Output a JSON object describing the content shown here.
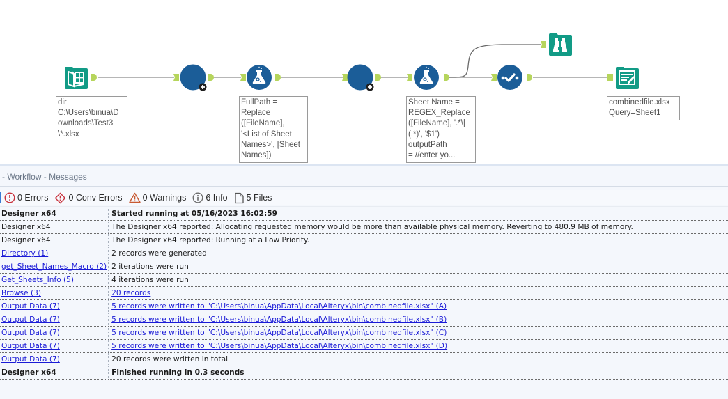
{
  "canvas": {
    "colors": {
      "teal": "#129b86",
      "blue": "#1b5d98",
      "anchor": "#b6d55c",
      "wire": "#8a8a8a"
    },
    "tools": [
      {
        "id": "directory",
        "name": "Directory",
        "icon": "directory-icon",
        "annotation": "dir\nC:\\Users\\binua\\D\nownloads\\Test3\n\\*.xlsx"
      },
      {
        "id": "get-sheet-names-macro",
        "name": "get_Sheet_Names_Macro",
        "icon": "macro-icon",
        "annotation": ""
      },
      {
        "id": "formula-1",
        "name": "Formula",
        "icon": "formula-flask-icon",
        "annotation": "FullPath =\nReplace\n([FileName],\n'<List of Sheet\nNames>', [Sheet\nNames])"
      },
      {
        "id": "get-sheets-info",
        "name": "Get_Sheets_Info",
        "icon": "macro-icon",
        "annotation": ""
      },
      {
        "id": "formula-2",
        "name": "Formula",
        "icon": "formula-flask-icon",
        "annotation": "Sheet Name =\nREGEX_Replace\n([FileName], '.*\\|\n(.*)', '$1')\noutputPath\n= //enter yo..."
      },
      {
        "id": "browse",
        "name": "Browse",
        "icon": "binoculars-icon",
        "annotation": ""
      },
      {
        "id": "select",
        "name": "Select",
        "icon": "select-check-icon",
        "annotation": ""
      },
      {
        "id": "output-data",
        "name": "Output Data",
        "icon": "output-data-icon",
        "annotation": "combinedfile.xlsx\nQuery=Sheet1"
      }
    ]
  },
  "messages_panel": {
    "title": "- Workflow - Messages",
    "filters": [
      {
        "icon": "error-icon",
        "label": "0 Errors"
      },
      {
        "icon": "conv-error-icon",
        "label": "0 Conv Errors"
      },
      {
        "icon": "warning-icon",
        "label": "0 Warnings"
      },
      {
        "icon": "info-icon",
        "label": "6 Info"
      },
      {
        "icon": "file-icon",
        "label": "5 Files"
      }
    ],
    "rows": [
      {
        "source": "Designer x64",
        "source_link": false,
        "message": "Started running at 05/16/2023 16:02:59",
        "message_link": false,
        "bold": true
      },
      {
        "source": "Designer x64",
        "source_link": false,
        "message": "The Designer x64 reported: Allocating requested memory would be more than available physical memory. Reverting to 480.9 MB of memory.",
        "message_link": false,
        "bold": false
      },
      {
        "source": "Designer x64",
        "source_link": false,
        "message": "The Designer x64 reported: Running at a Low Priority.",
        "message_link": false,
        "bold": false
      },
      {
        "source": "Directory (1)",
        "source_link": true,
        "message": "2 records were generated",
        "message_link": false,
        "bold": false
      },
      {
        "source": "get_Sheet_Names_Macro (2)",
        "source_link": true,
        "message": "2 iterations were run",
        "message_link": false,
        "bold": false
      },
      {
        "source": "Get_Sheets_Info (5)",
        "source_link": true,
        "message": "4 iterations were run",
        "message_link": false,
        "bold": false
      },
      {
        "source": "Browse (3)",
        "source_link": true,
        "message": "20 records",
        "message_link": true,
        "bold": false
      },
      {
        "source": "Output Data (7)",
        "source_link": true,
        "message": "5 records were written to \"C:\\Users\\binua\\AppData\\Local\\Alteryx\\bin\\combinedfile.xlsx\" (A)",
        "message_link": true,
        "bold": false
      },
      {
        "source": "Output Data (7)",
        "source_link": true,
        "message": "5 records were written to \"C:\\Users\\binua\\AppData\\Local\\Alteryx\\bin\\combinedfile.xlsx\" (B)",
        "message_link": true,
        "bold": false
      },
      {
        "source": "Output Data (7)",
        "source_link": true,
        "message": "5 records were written to \"C:\\Users\\binua\\AppData\\Local\\Alteryx\\bin\\combinedfile.xlsx\" (C)",
        "message_link": true,
        "bold": false
      },
      {
        "source": "Output Data (7)",
        "source_link": true,
        "message": "5 records were written to \"C:\\Users\\binua\\AppData\\Local\\Alteryx\\bin\\combinedfile.xlsx\" (D)",
        "message_link": true,
        "bold": false
      },
      {
        "source": "Output Data (7)",
        "source_link": true,
        "message": "20 records were written in total",
        "message_link": false,
        "bold": false
      },
      {
        "source": "Designer x64",
        "source_link": false,
        "message": "Finished running in 0.3 seconds",
        "message_link": false,
        "bold": true
      }
    ]
  }
}
